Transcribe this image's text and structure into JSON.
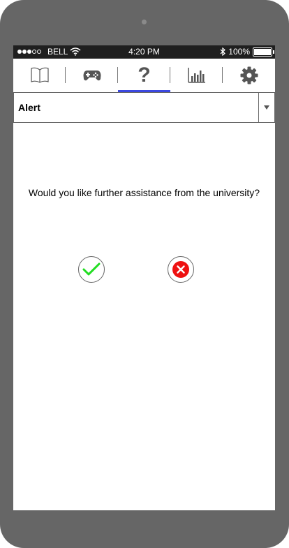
{
  "status_bar": {
    "signal_dots_filled": 3,
    "signal_dots_total": 5,
    "carrier": "BELL",
    "time": "4:20 PM",
    "battery": "100%"
  },
  "tabs": [
    {
      "id": "book",
      "icon": "book-icon",
      "active": false
    },
    {
      "id": "games",
      "icon": "gamepad-icon",
      "active": false
    },
    {
      "id": "help",
      "icon": "question-mark-icon",
      "glyph": "?",
      "active": true
    },
    {
      "id": "stats",
      "icon": "bar-chart-icon",
      "active": false
    },
    {
      "id": "settings",
      "icon": "gear-icon",
      "active": false
    }
  ],
  "dropdown": {
    "selected": "Alert"
  },
  "dialog": {
    "message": "Would you like further assistance from the university?",
    "confirm_icon": "checkmark-icon",
    "cancel_icon": "close-icon"
  },
  "colors": {
    "accent": "#3b48e0",
    "confirm": "#22dd22",
    "cancel": "#ee1111",
    "device": "#666666",
    "status_bar": "#1f1f1f"
  }
}
